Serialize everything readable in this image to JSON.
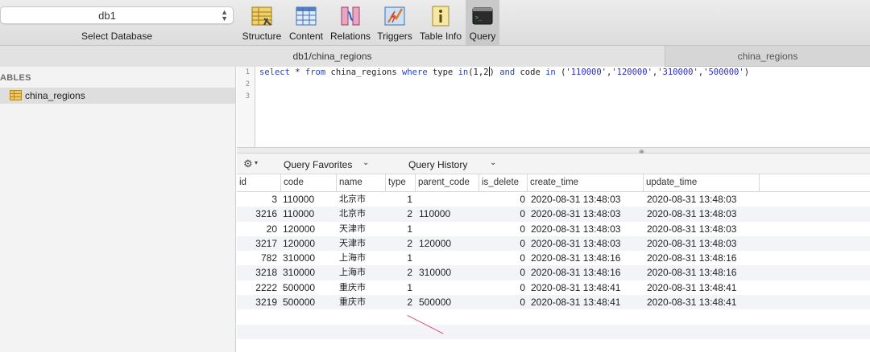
{
  "toolbar": {
    "database_value": "db1",
    "database_caption": "Select Database",
    "buttons": [
      {
        "label": "Structure",
        "icon": "structure-icon"
      },
      {
        "label": "Content",
        "icon": "content-icon"
      },
      {
        "label": "Relations",
        "icon": "relations-icon"
      },
      {
        "label": "Triggers",
        "icon": "triggers-icon"
      },
      {
        "label": "Table Info",
        "icon": "table-info-icon"
      },
      {
        "label": "Query",
        "icon": "query-terminal-icon",
        "active": true
      }
    ]
  },
  "tabs": {
    "left": "db1/china_regions",
    "right": "china_regions"
  },
  "sidebar": {
    "heading": "ABLES",
    "items": [
      {
        "label": "china_regions",
        "icon": "table-icon"
      }
    ]
  },
  "editor": {
    "line_numbers": [
      "1",
      "2",
      "3"
    ],
    "query": "select * from china_regions where type in(1,2) and code in ('110000','120000','310000','500000')"
  },
  "query_bar": {
    "favorites_label": "Query Favorites",
    "history_label": "Query History"
  },
  "results": {
    "columns": [
      "id",
      "code",
      "name",
      "type",
      "parent_code",
      "is_delete",
      "create_time",
      "update_time"
    ],
    "rows": [
      [
        "3",
        "110000",
        "北京市",
        "1",
        "",
        "0",
        "2020-08-31 13:48:03",
        "2020-08-31 13:48:03"
      ],
      [
        "3216",
        "110000",
        "北京市",
        "2",
        "110000",
        "0",
        "2020-08-31 13:48:03",
        "2020-08-31 13:48:03"
      ],
      [
        "20",
        "120000",
        "天津市",
        "1",
        "",
        "0",
        "2020-08-31 13:48:03",
        "2020-08-31 13:48:03"
      ],
      [
        "3217",
        "120000",
        "天津市",
        "2",
        "120000",
        "0",
        "2020-08-31 13:48:03",
        "2020-08-31 13:48:03"
      ],
      [
        "782",
        "310000",
        "上海市",
        "1",
        "",
        "0",
        "2020-08-31 13:48:16",
        "2020-08-31 13:48:16"
      ],
      [
        "3218",
        "310000",
        "上海市",
        "2",
        "310000",
        "0",
        "2020-08-31 13:48:16",
        "2020-08-31 13:48:16"
      ],
      [
        "2222",
        "500000",
        "重庆市",
        "1",
        "",
        "0",
        "2020-08-31 13:48:41",
        "2020-08-31 13:48:41"
      ],
      [
        "3219",
        "500000",
        "重庆市",
        "2",
        "500000",
        "0",
        "2020-08-31 13:48:41",
        "2020-08-31 13:48:41"
      ]
    ]
  },
  "colors": {
    "keyword": "#1f3fcf",
    "annotation_mark": "#e0506a",
    "row_alt": "#f2f4f7"
  }
}
